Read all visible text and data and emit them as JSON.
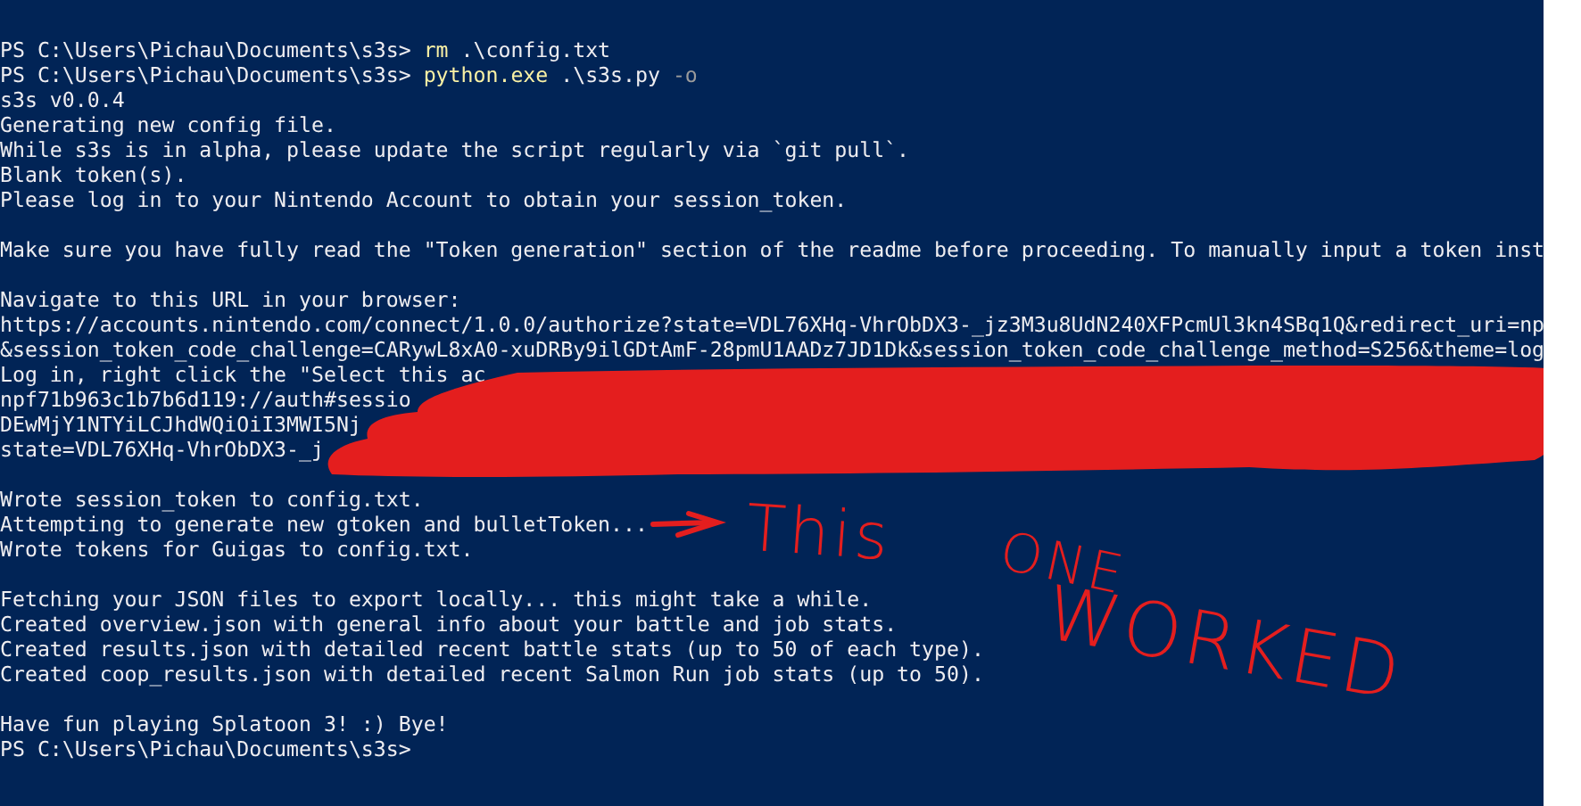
{
  "terminal": {
    "lines": [
      {
        "kind": "text",
        "segments": [
          {
            "kind": "prompt",
            "text": "PS C:\\Users\\Pichau\\Documents\\s3s> "
          },
          {
            "kind": "command",
            "text": "rm"
          },
          {
            "kind": "output",
            "text": " .\\config.txt"
          }
        ]
      },
      {
        "kind": "text",
        "segments": [
          {
            "kind": "prompt",
            "text": "PS C:\\Users\\Pichau\\Documents\\s3s> "
          },
          {
            "kind": "command",
            "text": "python.exe"
          },
          {
            "kind": "output",
            "text": " .\\s3s.py"
          },
          {
            "kind": "flag",
            "text": " -o"
          }
        ]
      },
      {
        "kind": "text",
        "segments": [
          {
            "kind": "output",
            "text": "s3s v0.0.4"
          }
        ]
      },
      {
        "kind": "text",
        "segments": [
          {
            "kind": "output",
            "text": "Generating new config file."
          }
        ]
      },
      {
        "kind": "text",
        "segments": [
          {
            "kind": "output",
            "text": "While s3s is in alpha, please update the script regularly via `git pull`."
          }
        ]
      },
      {
        "kind": "text",
        "segments": [
          {
            "kind": "output",
            "text": "Blank token(s)."
          }
        ]
      },
      {
        "kind": "text",
        "segments": [
          {
            "kind": "output",
            "text": "Please log in to your Nintendo Account to obtain your session_token."
          }
        ]
      },
      {
        "kind": "blank"
      },
      {
        "kind": "text",
        "segments": [
          {
            "kind": "output",
            "text": "Make sure you have fully read the \"Token generation\" section of the readme before proceeding. To manually input a token inst"
          }
        ]
      },
      {
        "kind": "blank"
      },
      {
        "kind": "text",
        "segments": [
          {
            "kind": "output",
            "text": "Navigate to this URL in your browser:"
          }
        ]
      },
      {
        "kind": "text",
        "segments": [
          {
            "kind": "output",
            "text": "https://accounts.nintendo.com/connect/1.0.0/authorize?state=VDL76XHq-VhrObDX3-_jz3M3u8UdN240XFPcmUl3kn4SBq1Q&redirect_uri=np"
          }
        ]
      },
      {
        "kind": "text",
        "segments": [
          {
            "kind": "output",
            "text": "&session_token_code_challenge=CARywL8xA0-xuDRBy9ilGDtAmF-28pmU1AADz7JD1Dk&session_token_code_challenge_method=S256&theme=log"
          }
        ]
      },
      {
        "kind": "text",
        "segments": [
          {
            "kind": "output",
            "text": "Log in, right click the \"Select this ac"
          }
        ]
      },
      {
        "kind": "text",
        "segments": [
          {
            "kind": "output",
            "text": "npf71b963c1b7b6d119://auth#sessio"
          }
        ]
      },
      {
        "kind": "text",
        "segments": [
          {
            "kind": "output",
            "text": "DEwMjY1NTYiLCJhdWQiOiI3MWI5Nj"
          }
        ]
      },
      {
        "kind": "text",
        "segments": [
          {
            "kind": "output",
            "text": "state=VDL76XHq-VhrObDX3-_j"
          }
        ]
      },
      {
        "kind": "blank"
      },
      {
        "kind": "text",
        "segments": [
          {
            "kind": "output",
            "text": "Wrote session_token to config.txt."
          }
        ]
      },
      {
        "kind": "text",
        "segments": [
          {
            "kind": "output",
            "text": "Attempting to generate new gtoken and bulletToken..."
          }
        ]
      },
      {
        "kind": "text",
        "segments": [
          {
            "kind": "output",
            "text": "Wrote tokens for Guigas to config.txt."
          }
        ]
      },
      {
        "kind": "blank"
      },
      {
        "kind": "text",
        "segments": [
          {
            "kind": "output",
            "text": "Fetching your JSON files to export locally... this might take a while."
          }
        ]
      },
      {
        "kind": "text",
        "segments": [
          {
            "kind": "output",
            "text": "Created overview.json with general info about your battle and job stats."
          }
        ]
      },
      {
        "kind": "text",
        "segments": [
          {
            "kind": "output",
            "text": "Created results.json with detailed recent battle stats (up to 50 of each type)."
          }
        ]
      },
      {
        "kind": "text",
        "segments": [
          {
            "kind": "output",
            "text": "Created coop_results.json with detailed recent Salmon Run job stats (up to 50)."
          }
        ]
      },
      {
        "kind": "blank"
      },
      {
        "kind": "text",
        "segments": [
          {
            "kind": "output",
            "text": "Have fun playing Splatoon 3! :) Bye!"
          }
        ]
      },
      {
        "kind": "text",
        "segments": [
          {
            "kind": "prompt",
            "text": "PS C:\\Users\\Pichau\\Documents\\s3s>"
          }
        ]
      }
    ]
  },
  "annotations": [
    {
      "text": "This"
    },
    {
      "text": "ONE"
    },
    {
      "text": "WORKED"
    }
  ]
}
